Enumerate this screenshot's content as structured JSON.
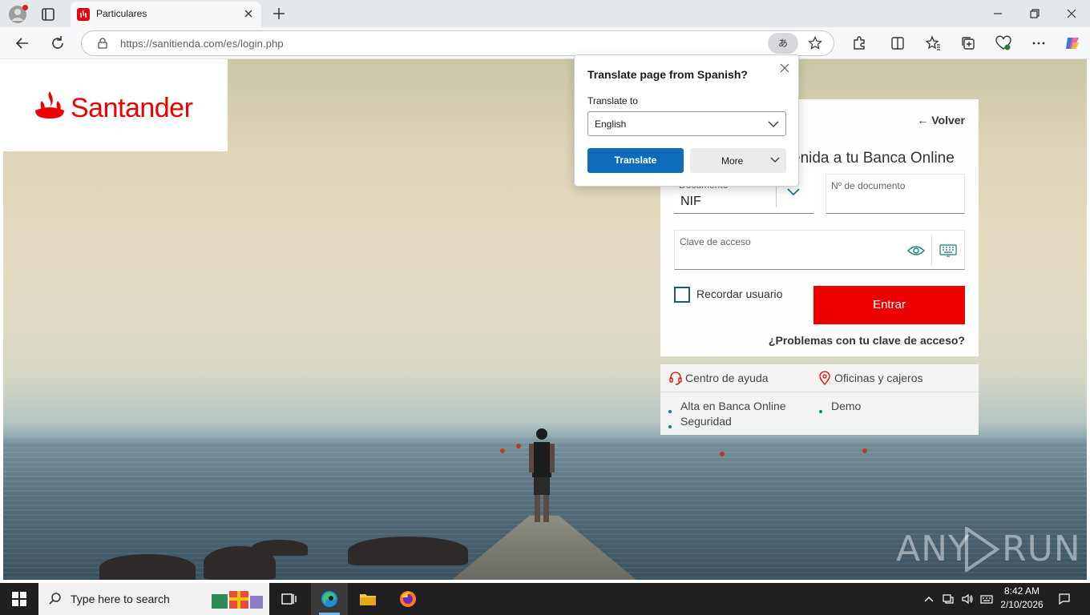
{
  "browser": {
    "tab_title": "Particulares",
    "url": "https://sanitienda.com/es/login.php",
    "translate_icon_label": "あ"
  },
  "page": {
    "brand": "Santander",
    "back_link": "← Volver",
    "welcome": "enida a tu Banca Online",
    "document_label": "Documento",
    "document_value": "NIF",
    "document_number_placeholder": "Nº de documento",
    "password_placeholder": "Clave de acceso",
    "remember_label": "Recordar usuario",
    "submit_label": "Entrar",
    "password_help": "¿Problemas con tu clave de acceso?",
    "help_center": "Centro de ayuda",
    "offices": "Oficinas y cajeros",
    "links_left": [
      "Alta en Banca Online",
      "Seguridad"
    ],
    "links_right": [
      "Demo"
    ],
    "watermark_left": "ANY",
    "watermark_right": "RUN"
  },
  "translate_popup": {
    "title": "Translate page from Spanish?",
    "label": "Translate to",
    "selected_language": "English",
    "translate_button": "Translate",
    "more_button": "More"
  },
  "taskbar": {
    "search_placeholder": "Type here to search",
    "time": "8:42 AM",
    "date": "2/10/2026"
  },
  "colors": {
    "brand_red": "#ec0000",
    "translate_blue": "#0f6cbd",
    "accent_teal": "#1b5a73"
  }
}
